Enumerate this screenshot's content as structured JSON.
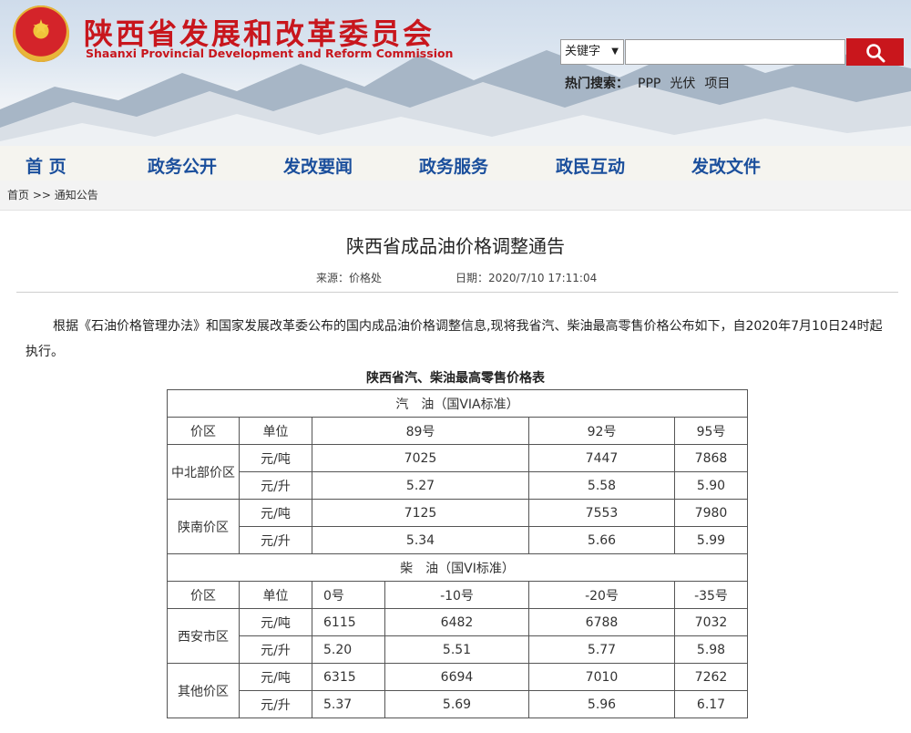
{
  "site": {
    "title_cn": "陕西省发展和改革委员会",
    "title_en": "Shaanxi Provincial Development and Reform Commission"
  },
  "search": {
    "select_value": "关键字",
    "placeholder": "",
    "button_icon": "search-icon",
    "hot_label": "热门搜索：",
    "hot_items": [
      "PPP",
      "光伏",
      "项目"
    ]
  },
  "nav": [
    "首 页",
    "政务公开",
    "发改要闻",
    "政务服务",
    "政民互动",
    "发改文件"
  ],
  "breadcrumb": "首页 >> 通知公告",
  "article": {
    "title": "陕西省成品油价格调整通告",
    "source": "来源：价格处",
    "date": "日期：2020/7/10 17:11:04",
    "body": "根据《石油价格管理办法》和国家发展改革委公布的国内成品油价格调整信息,现将我省汽、柴油最高零售价格公布如下，自2020年7月10日24时起执行。",
    "table_title": "陕西省汽、柴油最高零售价格表"
  },
  "table": {
    "gasoline": {
      "title": "汽　油（国VIA标准）",
      "h_region": "价区",
      "h_unit": "单位",
      "grades": [
        "89号",
        "92号",
        "95号"
      ],
      "rows": [
        {
          "region": "中北部价区",
          "unit_ton": "元/吨",
          "ton": [
            "7025",
            "7447",
            "7868"
          ],
          "unit_l": "元/升",
          "l": [
            "5.27",
            "5.58",
            "5.90"
          ]
        },
        {
          "region": "陕南价区",
          "unit_ton": "元/吨",
          "ton": [
            "7125",
            "7553",
            "7980"
          ],
          "unit_l": "元/升",
          "l": [
            "5.34",
            "5.66",
            "5.99"
          ]
        }
      ]
    },
    "diesel": {
      "title": "柴　油（国VI标准）",
      "h_region": "价区",
      "h_unit": "单位",
      "grades": [
        "0号",
        "-10号",
        "-20号",
        "-35号"
      ],
      "rows": [
        {
          "region": "西安市区",
          "unit_ton": "元/吨",
          "ton": [
            "6115",
            "6482",
            "6788",
            "7032"
          ],
          "unit_l": "元/升",
          "l": [
            "5.20",
            "5.51",
            "5.77",
            "5.98"
          ]
        },
        {
          "region": "其他价区",
          "unit_ton": "元/吨",
          "ton": [
            "6315",
            "6694",
            "7010",
            "7262"
          ],
          "unit_l": "元/升",
          "l": [
            "5.37",
            "5.69",
            "5.96",
            "6.17"
          ]
        }
      ]
    }
  }
}
